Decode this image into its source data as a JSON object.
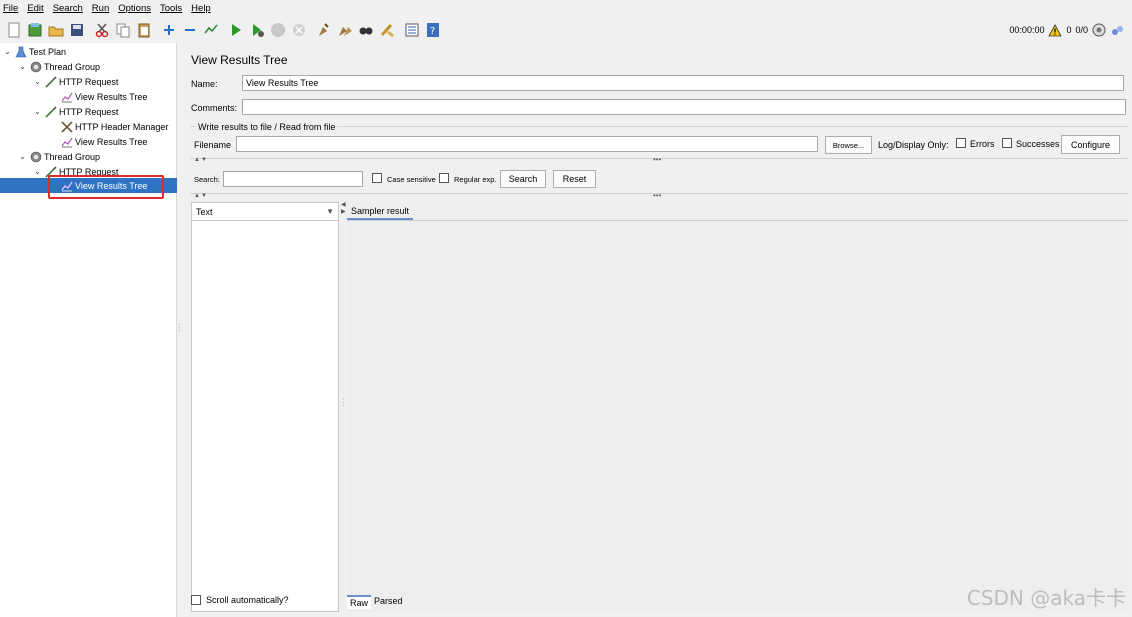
{
  "menu": [
    "File",
    "Edit",
    "Search",
    "Run",
    "Options",
    "Tools",
    "Help"
  ],
  "toolbar": {
    "icons": [
      "new-icon",
      "templates-icon",
      "open-icon",
      "save-icon",
      "cut-icon",
      "copy-icon",
      "paste-icon",
      "expand-icon",
      "collapse-icon",
      "toggle-icon",
      "start-icon",
      "start-no-pause-icon",
      "stop-icon",
      "shutdown-icon",
      "clear-icon",
      "clear-all-icon",
      "search-icon",
      "reset-search-icon",
      "function-helper-icon",
      "help-icon"
    ],
    "timer": "00:00:00",
    "warnings": "0",
    "threads": "0/0"
  },
  "tree": [
    {
      "label": "Test Plan",
      "level": 0,
      "icon": "test-plan-icon",
      "expanded": true
    },
    {
      "label": "Thread Group",
      "level": 1,
      "icon": "gear-icon",
      "expanded": true
    },
    {
      "label": "HTTP Request",
      "level": 2,
      "icon": "pipette-icon",
      "expanded": true
    },
    {
      "label": "View Results Tree",
      "level": 3,
      "icon": "chart-icon"
    },
    {
      "label": "HTTP Request",
      "level": 2,
      "icon": "pipette-icon",
      "expanded": true
    },
    {
      "label": "HTTP Header Manager",
      "level": 3,
      "icon": "wrench-icon"
    },
    {
      "label": "View Results Tree",
      "level": 3,
      "icon": "chart-icon"
    },
    {
      "label": "Thread Group",
      "level": 1,
      "icon": "gear-icon",
      "expanded": true
    },
    {
      "label": "HTTP Request",
      "level": 2,
      "icon": "pipette-icon",
      "expanded": true
    },
    {
      "label": "View Results Tree",
      "level": 3,
      "icon": "chart-icon",
      "selected": true
    }
  ],
  "panel": {
    "title": "View Results Tree",
    "name_label": "Name:",
    "name_value": "View Results Tree",
    "comments_label": "Comments:",
    "comments_value": "",
    "write_results": "Write results to file / Read from file",
    "filename_label": "Filename",
    "filename_value": "",
    "browse": "Browse...",
    "log_display": "Log/Display Only:",
    "errors": "Errors",
    "successes": "Successes",
    "configure": "Configure",
    "search_label": "Search:",
    "search_value": "",
    "case_sensitive": "Case sensitive",
    "regular_exp": "Regular exp.",
    "search_button": "Search",
    "reset_button": "Reset",
    "renderer": "Text",
    "sampler_tab": "Sampler result",
    "scroll_auto": "Scroll automatically?",
    "raw_tab": "Raw",
    "parsed_tab": "Parsed"
  },
  "watermark": "CSDN @aka卡卡"
}
